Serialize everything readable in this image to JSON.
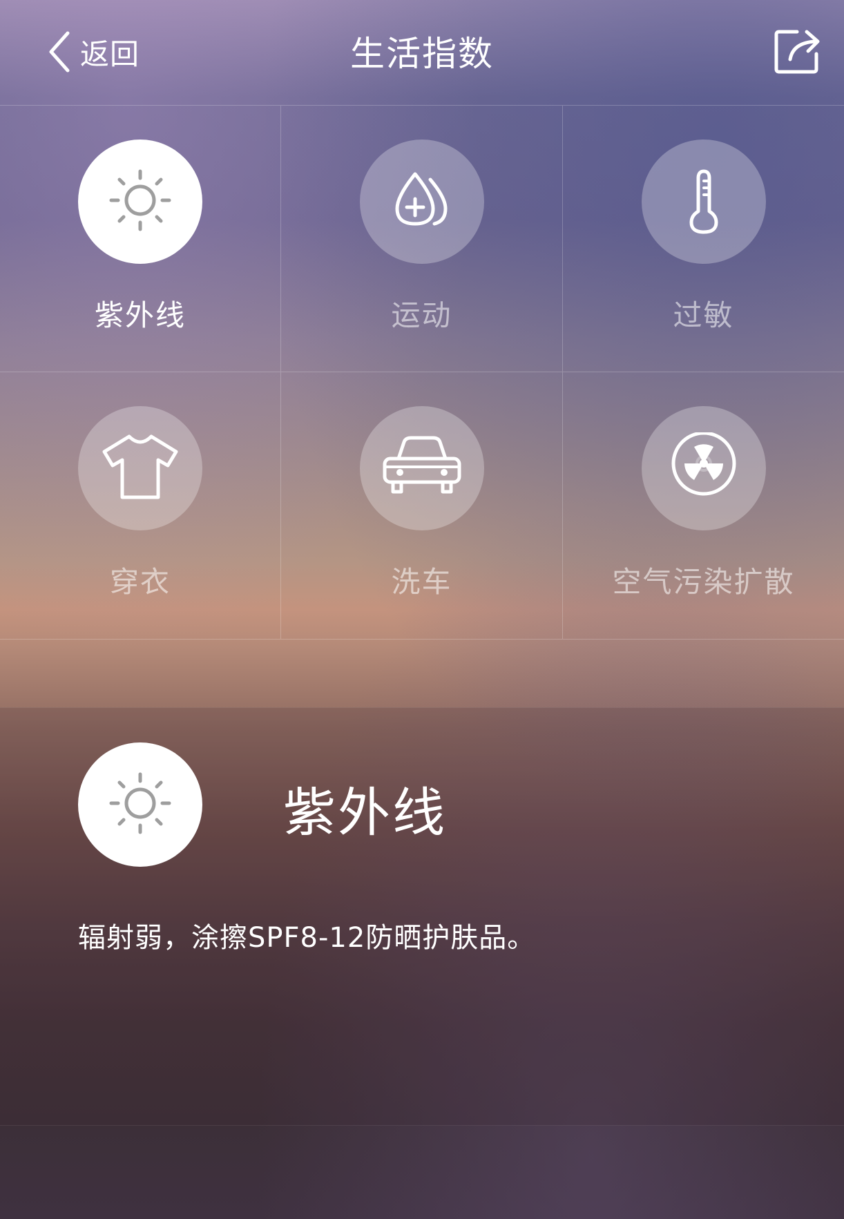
{
  "header": {
    "back_label": "返回",
    "title": "生活指数"
  },
  "grid": {
    "items": [
      {
        "label": "紫外线",
        "icon": "sun-icon",
        "active": true
      },
      {
        "label": "运动",
        "icon": "water-drops-plus-icon",
        "active": false
      },
      {
        "label": "过敏",
        "icon": "thermometer-icon",
        "active": false
      },
      {
        "label": "穿衣",
        "icon": "tshirt-icon",
        "active": false
      },
      {
        "label": "洗车",
        "icon": "car-icon",
        "active": false
      },
      {
        "label": "空气污染扩散",
        "icon": "radiation-icon",
        "active": false
      }
    ]
  },
  "detail": {
    "title": "紫外线",
    "icon": "sun-icon",
    "description": "辐射弱，涂擦SPF8-12防晒护肤品。"
  },
  "colors": {
    "icon_active_gray": "#9e9e9e",
    "icon_inactive_white": "#ffffff"
  }
}
